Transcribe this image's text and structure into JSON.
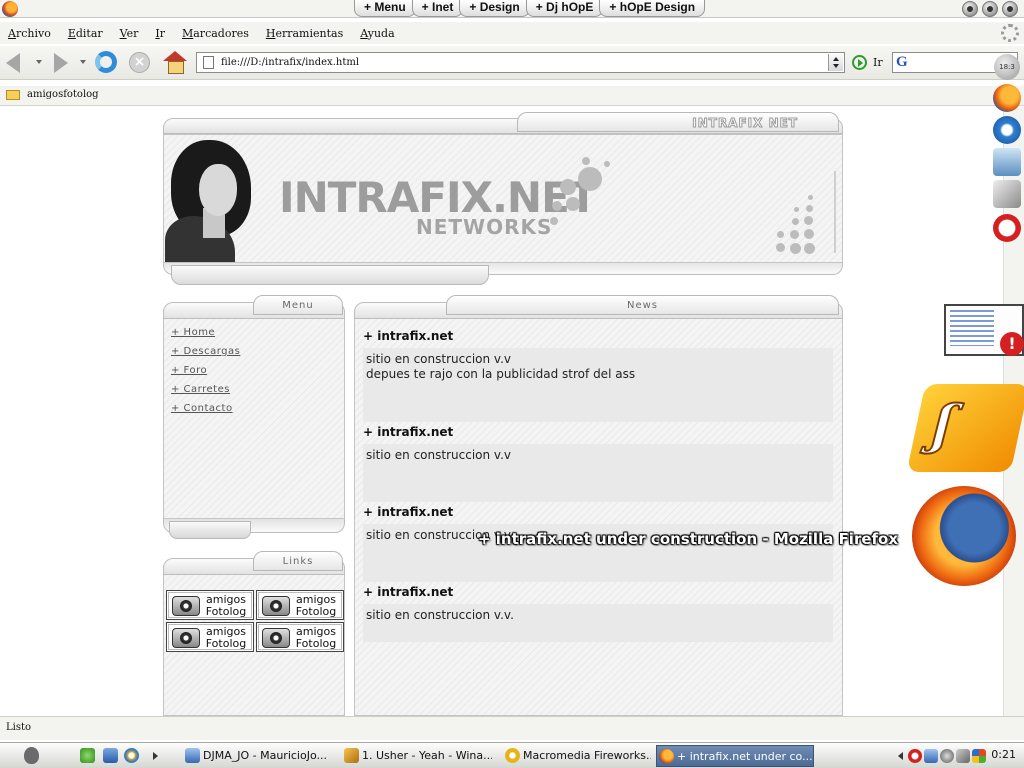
{
  "top_tabs": [
    "+ Menu",
    "+ Inet",
    "+ Design",
    "+ Dj hOpE",
    "+ hOpE Design"
  ],
  "menu": [
    "Archivo",
    "Editar",
    "Ver",
    "Ir",
    "Marcadores",
    "Herramientas",
    "Ayuda"
  ],
  "nav": {
    "url": "file:///D:/intrafix/index.html",
    "go_label": "Ir"
  },
  "bookmarks": [
    "amigosfotolog"
  ],
  "site": {
    "header_name": "INTRAFIX NET",
    "logo_main": "INTRAFIX.NET",
    "logo_sub": "NETWORKS",
    "menu_title": "Menu",
    "menu_items": [
      "+ Home",
      "+ Descargas",
      "+ Foro",
      "+ Carretes",
      "+ Contacto"
    ],
    "links_title": "Links",
    "link_badge": {
      "line1": "amigos",
      "line2": "Fotolog"
    },
    "news_title": "News",
    "news": [
      {
        "title": "+ intrafix.net",
        "lines": [
          "sitio en construccion v.v",
          "depues te rajo con la publicidad strof del ass"
        ]
      },
      {
        "title": "+ intrafix.net",
        "lines": [
          "sitio en construccion v.v"
        ]
      },
      {
        "title": "+ intrafix.net",
        "lines": [
          "sitio en construccion v.v"
        ]
      },
      {
        "title": "+ intrafix.net",
        "lines": [
          "sitio en construccion v.v."
        ]
      }
    ]
  },
  "dock": {
    "clock_text": "18:3"
  },
  "overlay_title": "+ intrafix.net under construction - Mozilla Firefox",
  "status_text": "Listo",
  "taskbar": {
    "tasks": [
      {
        "label": "DJMA_JO - MauricioJo...",
        "active": false
      },
      {
        "label": "1. Usher - Yeah - Wina...",
        "active": false
      },
      {
        "label": "Macromedia Fireworks...",
        "active": false
      },
      {
        "label": "+ intrafix.net under co...",
        "active": true
      }
    ],
    "clock": "0:21"
  },
  "colors": {
    "accent_task": "#4c6a94",
    "news_box": "#e9e9e9",
    "panel_hatch": "#f4f4f4"
  }
}
